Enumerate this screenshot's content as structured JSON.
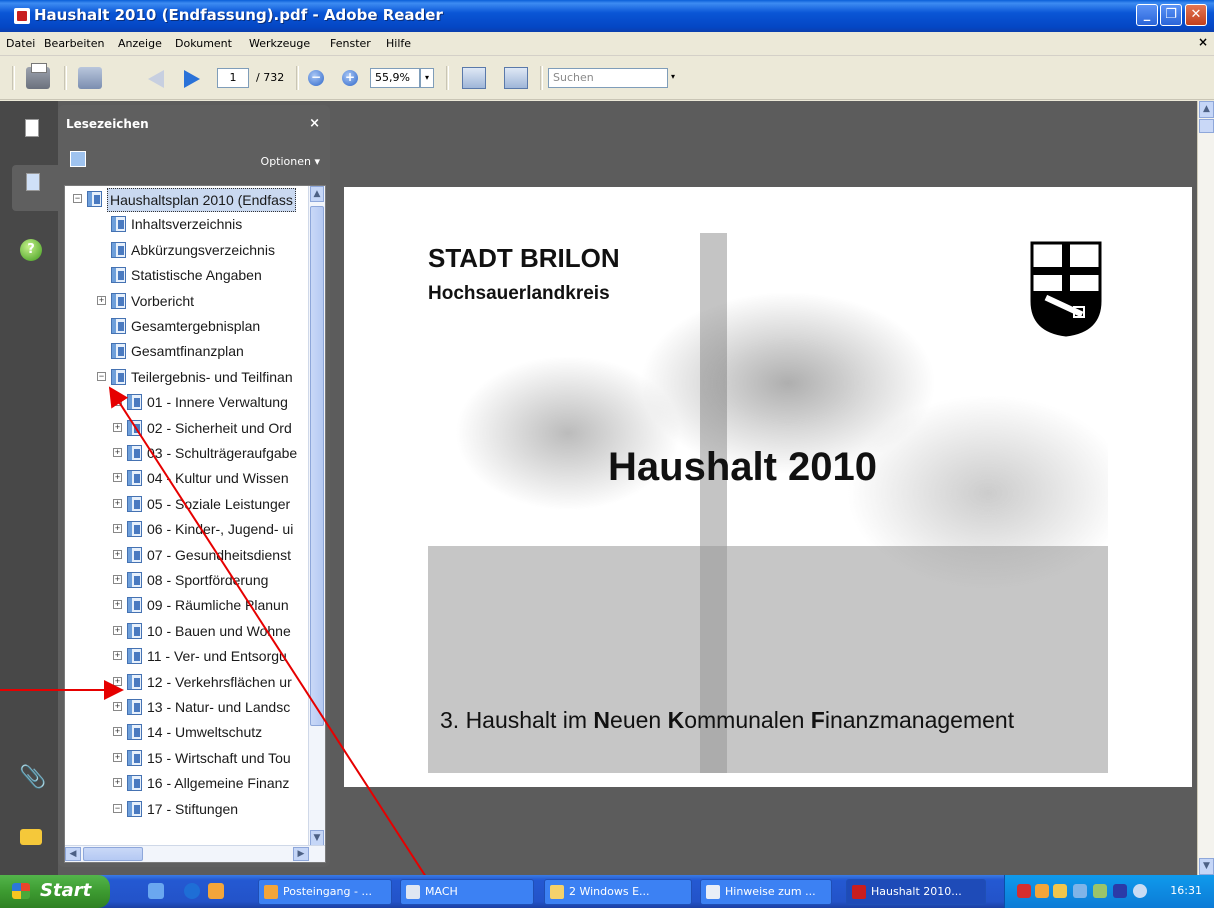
{
  "window": {
    "title": "Haushalt 2010 (Endfassung).pdf - Adobe Reader",
    "buttons": {
      "minimize": "_",
      "restore": "❐",
      "close": "✕"
    }
  },
  "menu": {
    "items": [
      "Datei",
      "Bearbeiten",
      "Anzeige",
      "Dokument",
      "Werkzeuge",
      "Fenster",
      "Hilfe"
    ],
    "close": "×"
  },
  "toolbar": {
    "current_page": "1",
    "page_total": "/ 732",
    "zoom_out": "−",
    "zoom_in": "+",
    "zoom": "55,9%",
    "dropdown_arrow": "▾",
    "search_placeholder": "Suchen"
  },
  "bookmarks_panel": {
    "title": "Lesezeichen",
    "close": "×",
    "options": "Optionen ▾",
    "tree": [
      {
        "label": "Haushaltsplan 2010 (Endfass",
        "expander": "−",
        "level": 0,
        "selected": true
      },
      {
        "label": "Inhaltsverzeichnis",
        "expander": "",
        "level": 1
      },
      {
        "label": "Abkürzungsverzeichnis",
        "expander": "",
        "level": 1
      },
      {
        "label": "Statistische Angaben",
        "expander": "",
        "level": 1
      },
      {
        "label": "Vorbericht",
        "expander": "+",
        "level": 1
      },
      {
        "label": "Gesamtergebnisplan",
        "expander": "",
        "level": 1
      },
      {
        "label": "Gesamtfinanzplan",
        "expander": "",
        "level": 1
      },
      {
        "label": "Teilergebnis- und Teilfinan",
        "expander": "−",
        "level": 1
      },
      {
        "label": "01 - Innere Verwaltung",
        "expander": "+",
        "level": 2
      },
      {
        "label": "02 - Sicherheit und Ord",
        "expander": "+",
        "level": 2
      },
      {
        "label": "03 - Schulträgeraufgabe",
        "expander": "+",
        "level": 2
      },
      {
        "label": "04 - Kultur und Wissen",
        "expander": "+",
        "level": 2
      },
      {
        "label": "05 - Soziale Leistunger",
        "expander": "+",
        "level": 2
      },
      {
        "label": "06 - Kinder-, Jugend- ui",
        "expander": "+",
        "level": 2
      },
      {
        "label": "07 - Gesundheitsdienst",
        "expander": "+",
        "level": 2
      },
      {
        "label": "08 - Sportförderung",
        "expander": "+",
        "level": 2
      },
      {
        "label": "09 - Räumliche Planun",
        "expander": "+",
        "level": 2
      },
      {
        "label": "10 - Bauen und Wohne",
        "expander": "+",
        "level": 2
      },
      {
        "label": "11 - Ver- und Entsorgu",
        "expander": "+",
        "level": 2
      },
      {
        "label": "12 - Verkehrsflächen ur",
        "expander": "+",
        "level": 2
      },
      {
        "label": "13 - Natur- und Landsc",
        "expander": "+",
        "level": 2
      },
      {
        "label": "14 - Umweltschutz",
        "expander": "+",
        "level": 2
      },
      {
        "label": "15 - Wirtschaft und Tou",
        "expander": "+",
        "level": 2
      },
      {
        "label": "16 - Allgemeine Finanz",
        "expander": "+",
        "level": 2
      },
      {
        "label": "17 - Stiftungen",
        "expander": "−",
        "level": 2
      }
    ],
    "scroll": {
      "up": "▲",
      "down": "▼",
      "left": "◀",
      "right": "▶"
    }
  },
  "document": {
    "city": "STADT BRILON",
    "district": "Hochsauerlandkreis",
    "heading": "Haushalt 2010",
    "footer": {
      "pre": "3. Haushalt im ",
      "n": "N",
      "n_rest": "euen ",
      "k": "K",
      "k_rest": "ommunalen ",
      "f": "F",
      "f_rest": "inanzmanagement"
    }
  },
  "taskbar": {
    "start": "Start",
    "tasks": [
      {
        "label": "Posteingang - ...",
        "active": false
      },
      {
        "label": "MACH",
        "active": false
      },
      {
        "label": "2 Windows E...",
        "active": false
      },
      {
        "label": "Hinweise zum ...",
        "active": false
      },
      {
        "label": "Haushalt 2010...",
        "active": true
      }
    ],
    "clock": "16:31"
  },
  "colors": {
    "accent": "#0a56d6",
    "annotation": "#e60000",
    "selected_bookmark": "#cad9f0"
  }
}
